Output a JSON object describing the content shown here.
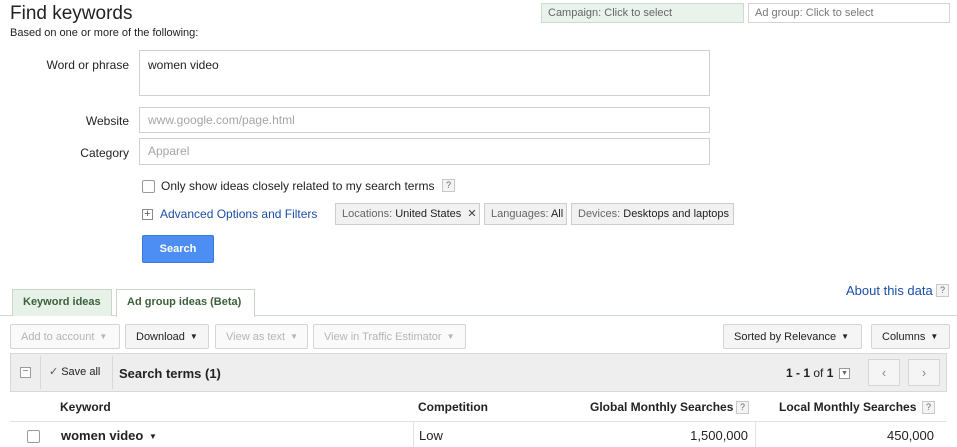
{
  "page": {
    "title": "Find keywords",
    "subtitle": "Based on one or more of the following:"
  },
  "pickers": {
    "campaign": "Campaign: Click to select",
    "ad_group": "Ad group: Click to select"
  },
  "form": {
    "word_label": "Word or phrase",
    "word_value": "women video",
    "website_label": "Website",
    "website_placeholder": "www.google.com/page.html",
    "category_label": "Category",
    "category_placeholder": "Apparel",
    "only_related_label": "Only show ideas closely related to my search terms",
    "help": "?",
    "advanced_link": "Advanced Options and Filters",
    "filters": {
      "locations_key": "Locations:",
      "locations_value": "United States",
      "remove": "✕",
      "languages_key": "Languages:",
      "languages_value": "All",
      "devices_key": "Devices:",
      "devices_value": "Desktops and laptops"
    },
    "search_button": "Search"
  },
  "tabs": {
    "keyword_ideas": "Keyword ideas",
    "ad_group_ideas": "Ad group ideas (Beta)"
  },
  "about": {
    "label": "About this data",
    "help": "?"
  },
  "toolbar": {
    "add_to_account": "Add to account",
    "download": "Download",
    "view_as_text": "View as text",
    "view_in_estimator": "View in Traffic Estimator",
    "sorted_by": "Sorted by Relevance",
    "columns": "Columns",
    "caret": "▼"
  },
  "grid": {
    "collapse": "−",
    "save_all": "Save all",
    "check": "✓",
    "section_title": "Search terms (1)",
    "pagination_range": "1 - 1",
    "pagination_of": "of",
    "pagination_total": "1",
    "prev": "‹",
    "next": "›",
    "columns": {
      "keyword": "Keyword",
      "competition": "Competition",
      "global": "Global Monthly Searches",
      "local": "Local Monthly Searches"
    },
    "rows": [
      {
        "keyword": "women video",
        "competition": "Low",
        "global": "1,500,000",
        "local": "450,000"
      }
    ]
  },
  "colors": {
    "link": "#1a4ea8",
    "primary_button": "#4d8ef4",
    "tab_green": "#e8f1e8"
  }
}
